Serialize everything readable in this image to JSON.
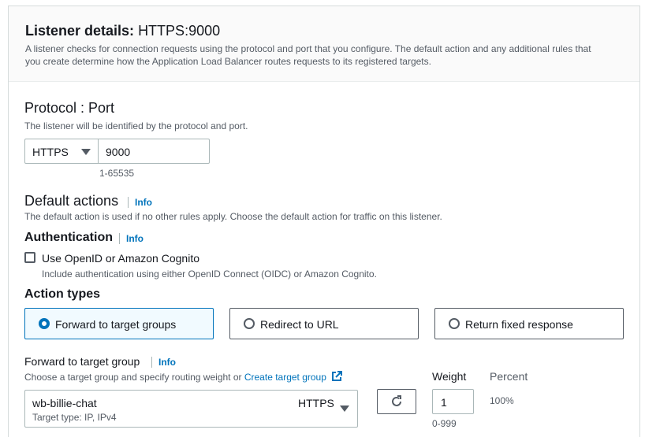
{
  "header": {
    "title_bold": "Listener details:",
    "title_value": "HTTPS:9000",
    "description_line1": "A listener checks for connection requests using the protocol and port that you configure. The default action and any additional rules that",
    "description_line2": "you create determine how the Application Load Balancer routes requests to its registered targets."
  },
  "protocol_port": {
    "heading": "Protocol : Port",
    "description": "The listener will be identified by the protocol and port.",
    "protocol_value": "HTTPS",
    "port_value": "9000",
    "port_hint": "1-65535"
  },
  "default_actions": {
    "heading": "Default actions",
    "info": "Info",
    "description": "The default action is used if no other rules apply. Choose the default action for traffic on this listener."
  },
  "authentication": {
    "heading": "Authentication",
    "info": "Info",
    "checkbox_label": "Use OpenID or Amazon Cognito",
    "checkbox_checked": false,
    "checkbox_description": "Include authentication using either OpenID Connect (OIDC) or Amazon Cognito."
  },
  "action_types": {
    "heading": "Action types",
    "options": [
      {
        "label": "Forward to target groups",
        "selected": true
      },
      {
        "label": "Redirect to URL",
        "selected": false
      },
      {
        "label": "Return fixed response",
        "selected": false
      }
    ]
  },
  "forward": {
    "label": "Forward to target group",
    "info": "Info",
    "description_prefix": "Choose a target group and specify routing weight or ",
    "create_link": "Create target group",
    "target_group_name": "wb-billie-chat",
    "target_group_type": "Target type: IP, IPv4",
    "target_group_protocol": "HTTPS",
    "weight_label": "Weight",
    "weight_value": "1",
    "weight_hint": "0-999",
    "percent_label": "Percent",
    "percent_value": "100%"
  },
  "colors": {
    "accent": "#0073bb",
    "text": "#16191f",
    "muted": "#545b64",
    "selected_bg": "#f1faff"
  },
  "icons": {
    "protocol_dropdown": "caret-down-icon",
    "refresh": "refresh-icon",
    "external_link": "external-link-icon",
    "target_group_dropdown": "caret-down-icon"
  }
}
